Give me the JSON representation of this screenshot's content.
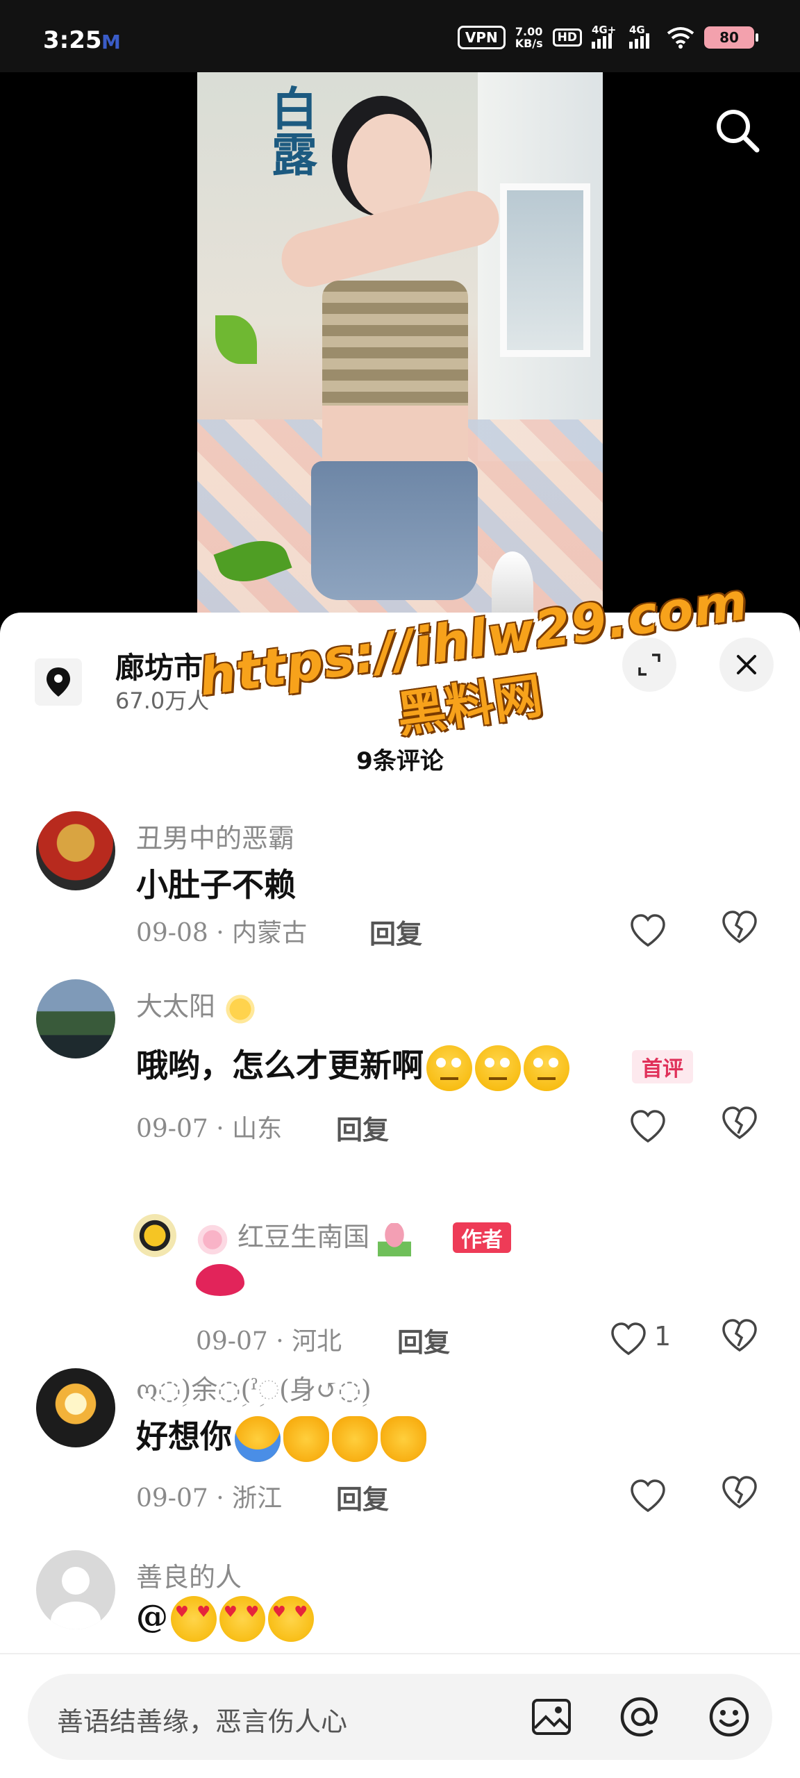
{
  "status": {
    "time": "3:25",
    "vpn": "VPN",
    "speed_value": "7.00",
    "speed_unit": "KB/s",
    "hd": "HD",
    "net1": "4G+",
    "net2": "4G",
    "battery": "80"
  },
  "header": {
    "location_title": "廊坊市",
    "location_sub": "67.0万人"
  },
  "watermark": {
    "line1": "https://ihlw29.com",
    "line2": "黑料网"
  },
  "comments_count": "9条评论",
  "comments": [
    {
      "name": "丑男中的恶霸",
      "text": "小肚子不赖",
      "meta": "09-08 · 内蒙古",
      "reply": "回复"
    },
    {
      "name": "大太阳",
      "text": "哦哟，怎么才更新啊",
      "meta": "09-07 · 山东",
      "reply": "回复",
      "badge": "首评"
    },
    {
      "name": "红豆生南国",
      "meta": "09-07 · 河北",
      "reply": "回复",
      "badge": "作者",
      "likes": "1"
    },
    {
      "name": "ო◌ؚ)余◌ؚ(ˀ◌ؚ(身↺◌ؚ)",
      "text": "好想你",
      "meta": "09-07 · 浙江",
      "reply": "回复"
    },
    {
      "name": "善良的人",
      "text": "@"
    }
  ],
  "input": {
    "placeholder": "善语结善缘，恶言伤人心"
  },
  "video_logo": "白露",
  "colors": {
    "accent_red": "#ee3b57",
    "watermark_orange": "#f7a21b",
    "battery_pink": "#f3a1ad"
  },
  "icons": [
    "search-icon",
    "location-pin-icon",
    "expand-icon",
    "close-icon",
    "heart-icon",
    "broken-heart-icon",
    "image-icon",
    "at-icon",
    "smile-icon"
  ]
}
